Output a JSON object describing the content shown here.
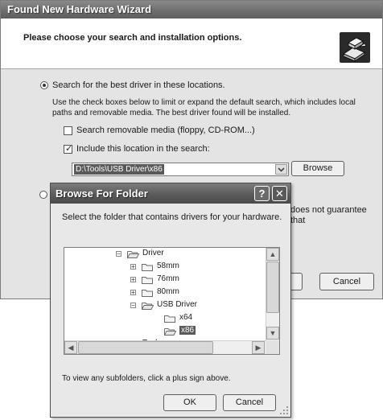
{
  "wizard": {
    "title": "Found New Hardware Wizard",
    "heading": "Please choose your search and installation options.",
    "option_search_label": "Search for the best driver in these locations.",
    "option_search_desc": "Use the check boxes below to limit or expand the default search, which includes local paths and removable media. The best driver found will be installed.",
    "check_removable_label": "Search removable media (floppy, CD-ROM...)",
    "check_removable_checked": false,
    "check_location_label": "Include this location in the search:",
    "check_location_checked": true,
    "location_value": "D:\\Tools\\USB Driver\\x86",
    "browse_label": "Browse",
    "side_note": "does not guarantee that",
    "cancel_label": "Cancel"
  },
  "browse_dialog": {
    "title": "Browse For Folder",
    "help_label": "?",
    "close_label": "✕",
    "instruction": "Select the folder that contains drivers for your hardware.",
    "tree": [
      {
        "label": "Driver",
        "toggle": "−",
        "depth": 0
      },
      {
        "label": "58mm",
        "toggle": "+",
        "depth": 1
      },
      {
        "label": "76mm",
        "toggle": "+",
        "depth": 1
      },
      {
        "label": "80mm",
        "toggle": "+",
        "depth": 1
      },
      {
        "label": "USB Driver",
        "toggle": "−",
        "depth": 1
      },
      {
        "label": "x64",
        "toggle": "",
        "depth": 2
      },
      {
        "label": "x86",
        "toggle": "",
        "depth": 2,
        "selected": true
      },
      {
        "label": "Tools",
        "toggle": "+",
        "depth": 0
      }
    ],
    "footer_text": "To view any subfolders, click a plus sign above.",
    "ok_label": "OK",
    "cancel_label": "Cancel"
  },
  "icons": {
    "hardware": "hardware-wizard-icon",
    "folder": "folder-icon",
    "folder_open": "open-folder-icon"
  },
  "colors": {
    "titlebar": "#6f6f6f",
    "selection": "#5a5a5a"
  }
}
